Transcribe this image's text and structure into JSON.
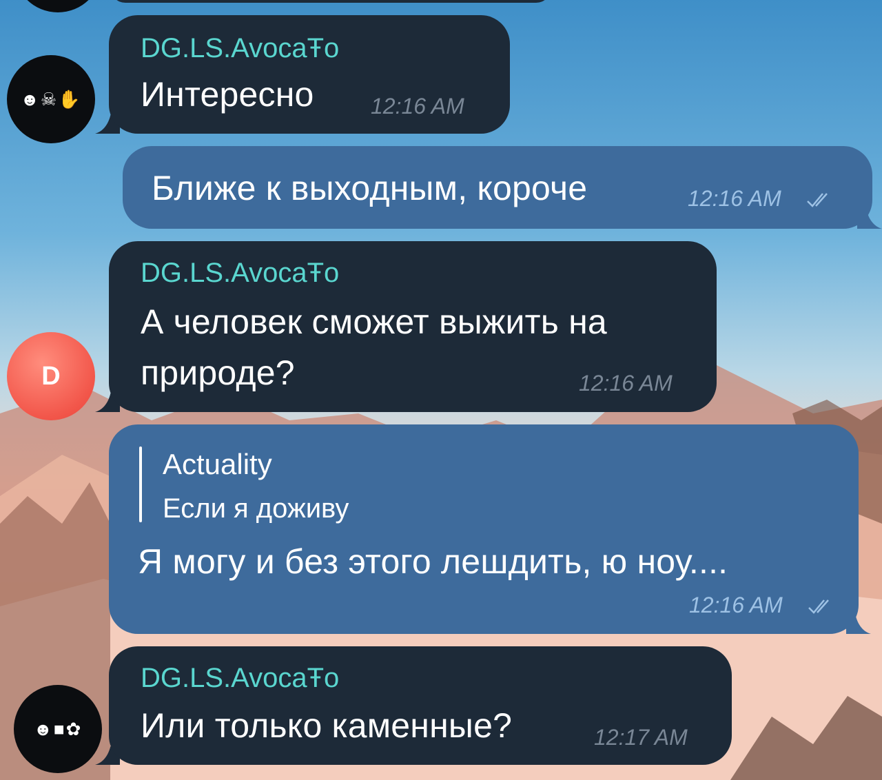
{
  "chat": {
    "messages": [
      {
        "sender": "DG.LS.AvocaŦo",
        "text": "Интересно",
        "time": "12:16 AM",
        "avatar": "skull-emoji-avatar"
      },
      {
        "text": "Ближе к выходным, короче",
        "time": "12:16 AM",
        "status": "read"
      },
      {
        "sender": "DG.LS.AvocaŦo",
        "text_line1": "А человек сможет выжить на",
        "text_line2": "природе?",
        "time": "12:16 AM",
        "avatar_letter": "D"
      },
      {
        "reply_name": "Actuality",
        "reply_text": "Если я доживу",
        "text": "Я могу и без этого лешдить, ю ноу....",
        "time": "12:16 AM",
        "status": "read"
      },
      {
        "sender": "DG.LS.AvocaŦo",
        "text": "Или только каменные?",
        "time": "12:17 AM",
        "avatar": "emoji-avatar"
      }
    ]
  },
  "colors": {
    "incoming_bubble": "#1d2a38",
    "outgoing_bubble": "#3e6b9c",
    "sender_name": "#5ad6cf"
  }
}
